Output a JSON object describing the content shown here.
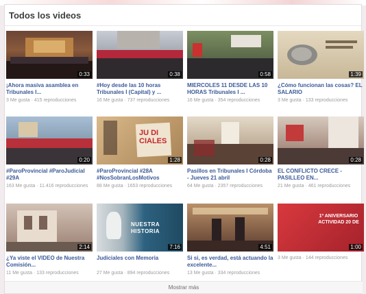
{
  "panel": {
    "title": "Todos los videos",
    "show_more": "Mostrar más"
  },
  "videos": [
    {
      "title": "¡Ahora masiva asamblea en Tribunales I...",
      "meta": "3 Me gusta · 415 reproducciones",
      "duration": "0:33"
    },
    {
      "title": "#Hoy desde las 10 horas Tribunales I (Capital) y ...",
      "meta": "16 Me gusta · 737 reproducciones",
      "duration": "0:38"
    },
    {
      "title": "MIERCOLES 11 DESDE LAS 10 HORAS Tribunales I ...",
      "meta": "16 Me gusta · 354 reproducciones",
      "duration": "0:58"
    },
    {
      "title": "¿Cómo funcionan las cosas? EL SALARIO",
      "meta": "3 Me gusta · 133 reproducciones",
      "duration": "1:39"
    },
    {
      "title": "#ParoProvincial #ParoJudicial #29A",
      "meta": "163 Me gusta · 11.416 reproducciones",
      "duration": "0:20"
    },
    {
      "title": "#ParoProvincial #28A #NosSobranLosMotivos",
      "meta": "88 Me gusta · 1653 reproducciones",
      "duration": "1:28"
    },
    {
      "title": "Pasillos en Tribunales I Córdoba - Jueves 21 abril",
      "meta": "64 Me gusta · 2357 reproducciones",
      "duration": "0:28"
    },
    {
      "title": "EL CONFLICTO CRECE - PASILLEO EN...",
      "meta": "21 Me gusta · 461 reproducciones",
      "duration": "0:28"
    },
    {
      "title": "¿Ya viste el VIDEO de Nuestra Comisión...",
      "meta": "11 Me gusta · 133 reproducciones",
      "duration": "2:14"
    },
    {
      "title": "Judiciales con Memoria",
      "meta": "27 Me gusta · 894 reproducciones",
      "duration": "7:16"
    },
    {
      "title": "Si si, es verdad, está actuando la excelente...",
      "meta": "13 Me gusta · 334 reproducciones",
      "duration": "4:51"
    },
    {
      "title": "",
      "meta": "3 Me gusta · 144 reproducciones",
      "duration": "1:00"
    }
  ],
  "thumb_overlays": {
    "sign_text": "JU DI CIALES",
    "history_text": "NUESTRA HISTORIA",
    "anniversary_text": "1º ANIVERSARIO ACTIVIDAD 20 DE"
  },
  "colors": {
    "link": "#3b5998",
    "meta": "#9b9b9b"
  }
}
